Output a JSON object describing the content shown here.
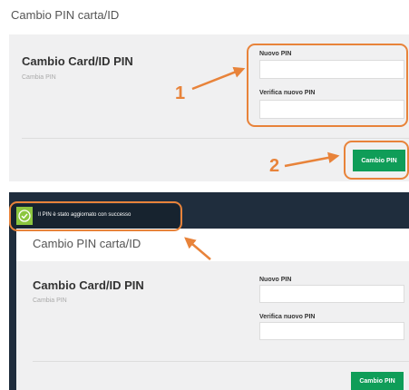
{
  "top": {
    "page_title": "Cambio PIN carta/ID",
    "card_title": "Cambio Card/ID PIN",
    "card_subtitle": "Cambia PIN",
    "new_pin_label": "Nuovo PIN",
    "verify_pin_label": "Verifica nuovo PIN",
    "submit_label": "Cambio PIN",
    "annotation_1": "1",
    "annotation_2": "2"
  },
  "bottom": {
    "toast_message": "Il PIN è stato aggiornato con successo",
    "page_title": "Cambio PIN carta/ID",
    "card_title": "Cambio Card/ID PIN",
    "card_subtitle": "Cambia PIN",
    "new_pin_label": "Nuovo PIN",
    "verify_pin_label": "Verifica nuovo PIN",
    "submit_label": "Cambio PIN"
  },
  "colors": {
    "accent_orange": "#e8833a",
    "button_green": "#0f9d58",
    "toast_check_green": "#8cc63f",
    "dark_navy": "#1f2d3d"
  },
  "icons": {
    "toast_icon": "check-circle-icon"
  }
}
